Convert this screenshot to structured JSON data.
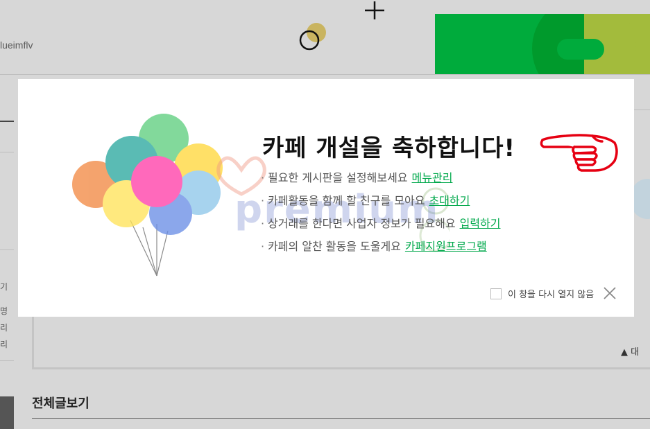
{
  "background": {
    "cafe_id": "lueimflv",
    "sidebar_chars": [
      "기",
      "명",
      "리",
      "리"
    ],
    "sort_label": "▲ 대",
    "all_posts_title": "전체글보기"
  },
  "popup": {
    "title": "카페 개설을 축하합니다!",
    "tips": [
      {
        "text": "필요한 게시판을 설정해보세요",
        "link": "메뉴관리"
      },
      {
        "text": "카페활동을 함께 할 친구를 모아요",
        "link": "초대하기"
      },
      {
        "text": "상거래를 한다면 사업자 정보가 필요해요",
        "link": "입력하기"
      },
      {
        "text": "카페의 알찬 활동을 도울게요",
        "link": "카페지원프로그램"
      }
    ],
    "dont_show_label": "이 창을 다시 열지 않음",
    "watermark": "premium"
  },
  "colors": {
    "accent_green": "#03a94d",
    "banner_green": "#00ab3c",
    "annotation_red": "#e60012"
  },
  "icons": {
    "pointing_hand": "pointing-hand-icon",
    "close": "close-icon",
    "balloons": "balloons-illustration"
  }
}
